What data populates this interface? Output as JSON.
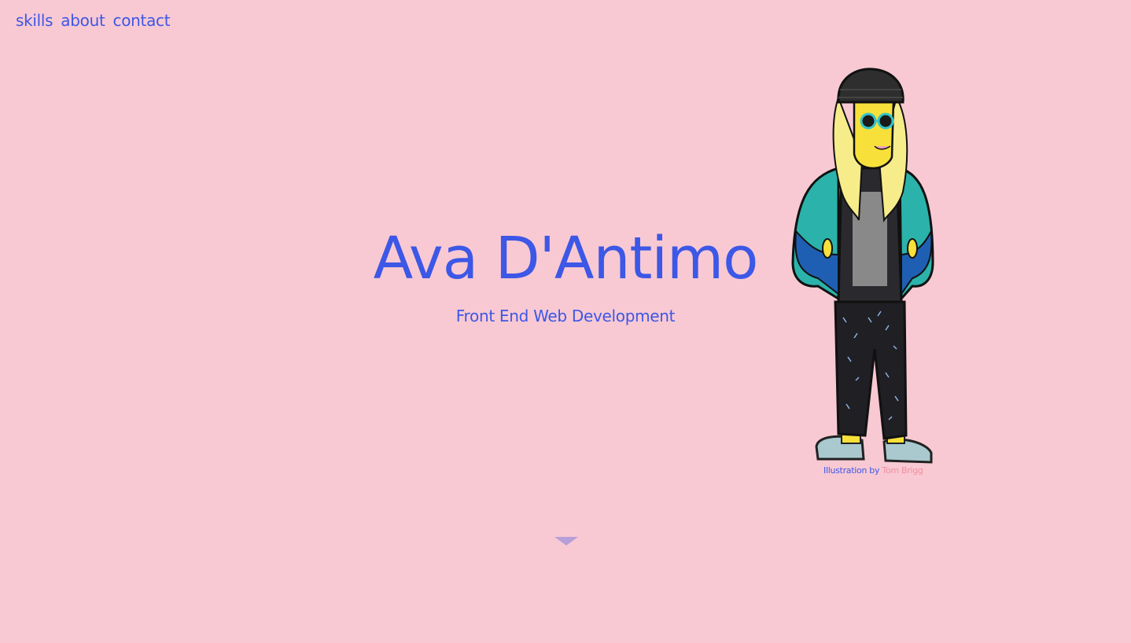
{
  "nav": {
    "items": [
      {
        "label": "skills"
      },
      {
        "label": "about"
      },
      {
        "label": "contact"
      }
    ]
  },
  "hero": {
    "title": "Ava D'Antimo",
    "subtitle": "Front End Web Development"
  },
  "illustration": {
    "credit_prefix": "Illustration by",
    "credit_artist": "Tom Brigg"
  },
  "icons": {
    "scroll_down": "triangle-down-icon"
  },
  "colors": {
    "background": "#f8c9d3",
    "accent": "#3d57e6",
    "credit_link": "#f08fa2",
    "arrow": "#b79fd8"
  }
}
